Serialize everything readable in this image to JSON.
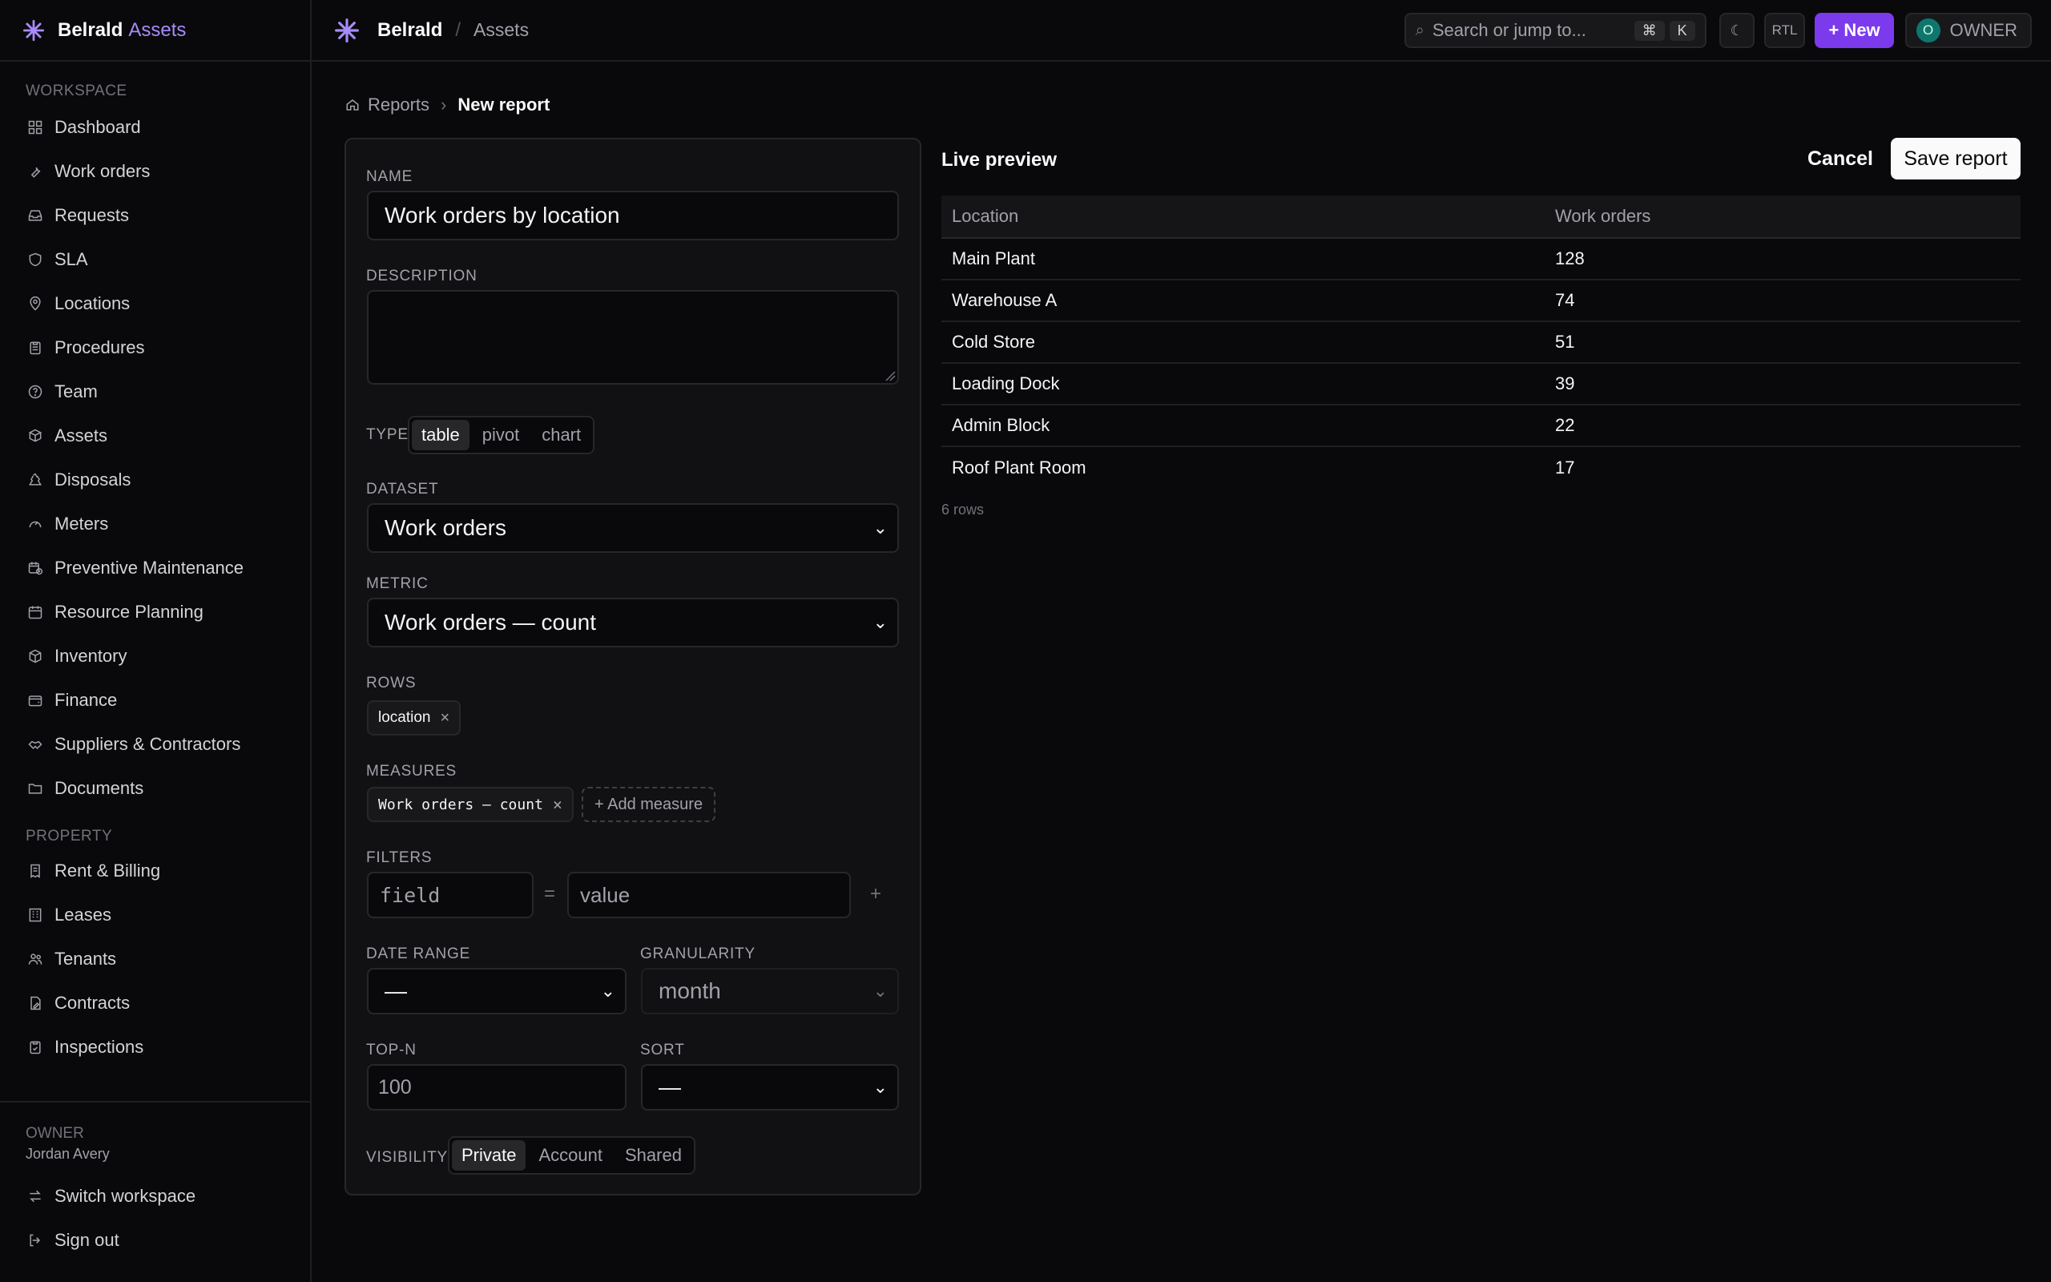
{
  "brand": {
    "name": "Belrald",
    "suffix": "Assets"
  },
  "topbar": {
    "org": "Belrald",
    "separator": "/",
    "section": "Assets",
    "search_placeholder": "Search or jump to...",
    "search_kbd": [
      "⌘",
      "K"
    ],
    "theme_glyph": "☾",
    "rtl_label": "RTL",
    "new_label": "+ New",
    "owner_initial": "O",
    "owner_label": "OWNER"
  },
  "sidebar": {
    "workspace_label": "WORKSPACE",
    "workspace_items": [
      {
        "label": "Dashboard",
        "icon": "dashboard-icon"
      },
      {
        "label": "Work orders",
        "icon": "wrench-icon"
      },
      {
        "label": "Requests",
        "icon": "inbox-icon"
      },
      {
        "label": "SLA",
        "icon": "shield-icon"
      },
      {
        "label": "Locations",
        "icon": "map-pin-icon"
      },
      {
        "label": "Procedures",
        "icon": "clipboard-icon"
      },
      {
        "label": "Team",
        "icon": "help-circle-icon"
      },
      {
        "label": "Assets",
        "icon": "boxes-icon"
      },
      {
        "label": "Disposals",
        "icon": "recycle-icon"
      },
      {
        "label": "Meters",
        "icon": "gauge-icon"
      },
      {
        "label": "Preventive Maintenance",
        "icon": "calendar-clock-icon"
      },
      {
        "label": "Resource Planning",
        "icon": "calendar-icon"
      },
      {
        "label": "Inventory",
        "icon": "package-icon"
      },
      {
        "label": "Finance",
        "icon": "wallet-icon"
      },
      {
        "label": "Suppliers & Contractors",
        "icon": "handshake-icon"
      },
      {
        "label": "Documents",
        "icon": "folder-icon"
      }
    ],
    "property_label": "PROPERTY",
    "property_items": [
      {
        "label": "Rent & Billing",
        "icon": "receipt-icon"
      },
      {
        "label": "Leases",
        "icon": "building-icon"
      },
      {
        "label": "Tenants",
        "icon": "users-icon"
      },
      {
        "label": "Contracts",
        "icon": "file-pen-icon"
      },
      {
        "label": "Inspections",
        "icon": "clipboard-check-icon"
      }
    ],
    "owner_role": "OWNER",
    "owner_name": "Jordan Avery",
    "switch_workspace": "Switch workspace",
    "sign_out": "Sign out"
  },
  "breadcrumb": {
    "parent": "Reports",
    "current": "New report"
  },
  "form": {
    "name_label": "NAME",
    "name_value": "Work orders by location",
    "description_label": "DESCRIPTION",
    "description_value": "",
    "type_label": "TYPE",
    "type_options": [
      "table",
      "pivot",
      "chart"
    ],
    "type_selected": "table",
    "dataset_label": "DATASET",
    "dataset_value": "Work orders",
    "metric_label": "METRIC",
    "metric_value": "Work orders — count",
    "rows_label": "ROWS",
    "rows_chips": [
      "location"
    ],
    "measures_label": "MEASURES",
    "measures_chips": [
      "Work orders — count"
    ],
    "add_measure": "+ Add measure",
    "filters_label": "FILTERS",
    "filter_field_placeholder": "field",
    "filter_op": "=",
    "filter_value_placeholder": "value",
    "filter_add": "+",
    "date_range_label": "DATE RANGE",
    "date_range_value": "—",
    "granularity_label": "GRANULARITY",
    "granularity_value": "month",
    "topn_label": "TOP-N",
    "topn_placeholder": "100",
    "sort_label": "SORT",
    "sort_value": "—",
    "visibility_label": "VISIBILITY",
    "visibility_options": [
      "Private",
      "Account",
      "Shared"
    ],
    "visibility_selected": "Private"
  },
  "preview": {
    "title": "Live preview",
    "cancel_label": "Cancel",
    "save_label": "Save report",
    "columns": [
      "Location",
      "Work orders"
    ],
    "rows": [
      [
        "Main Plant",
        "128"
      ],
      [
        "Warehouse A",
        "74"
      ],
      [
        "Cold Store",
        "51"
      ],
      [
        "Loading Dock",
        "39"
      ],
      [
        "Admin Block",
        "22"
      ],
      [
        "Roof Plant Room",
        "17"
      ]
    ],
    "row_count": "6 rows"
  },
  "colors": {
    "accent": "#7c3aed",
    "accent_text": "#a78bfa",
    "background": "#09090b",
    "panel": "#111113",
    "border": "#27272a"
  }
}
